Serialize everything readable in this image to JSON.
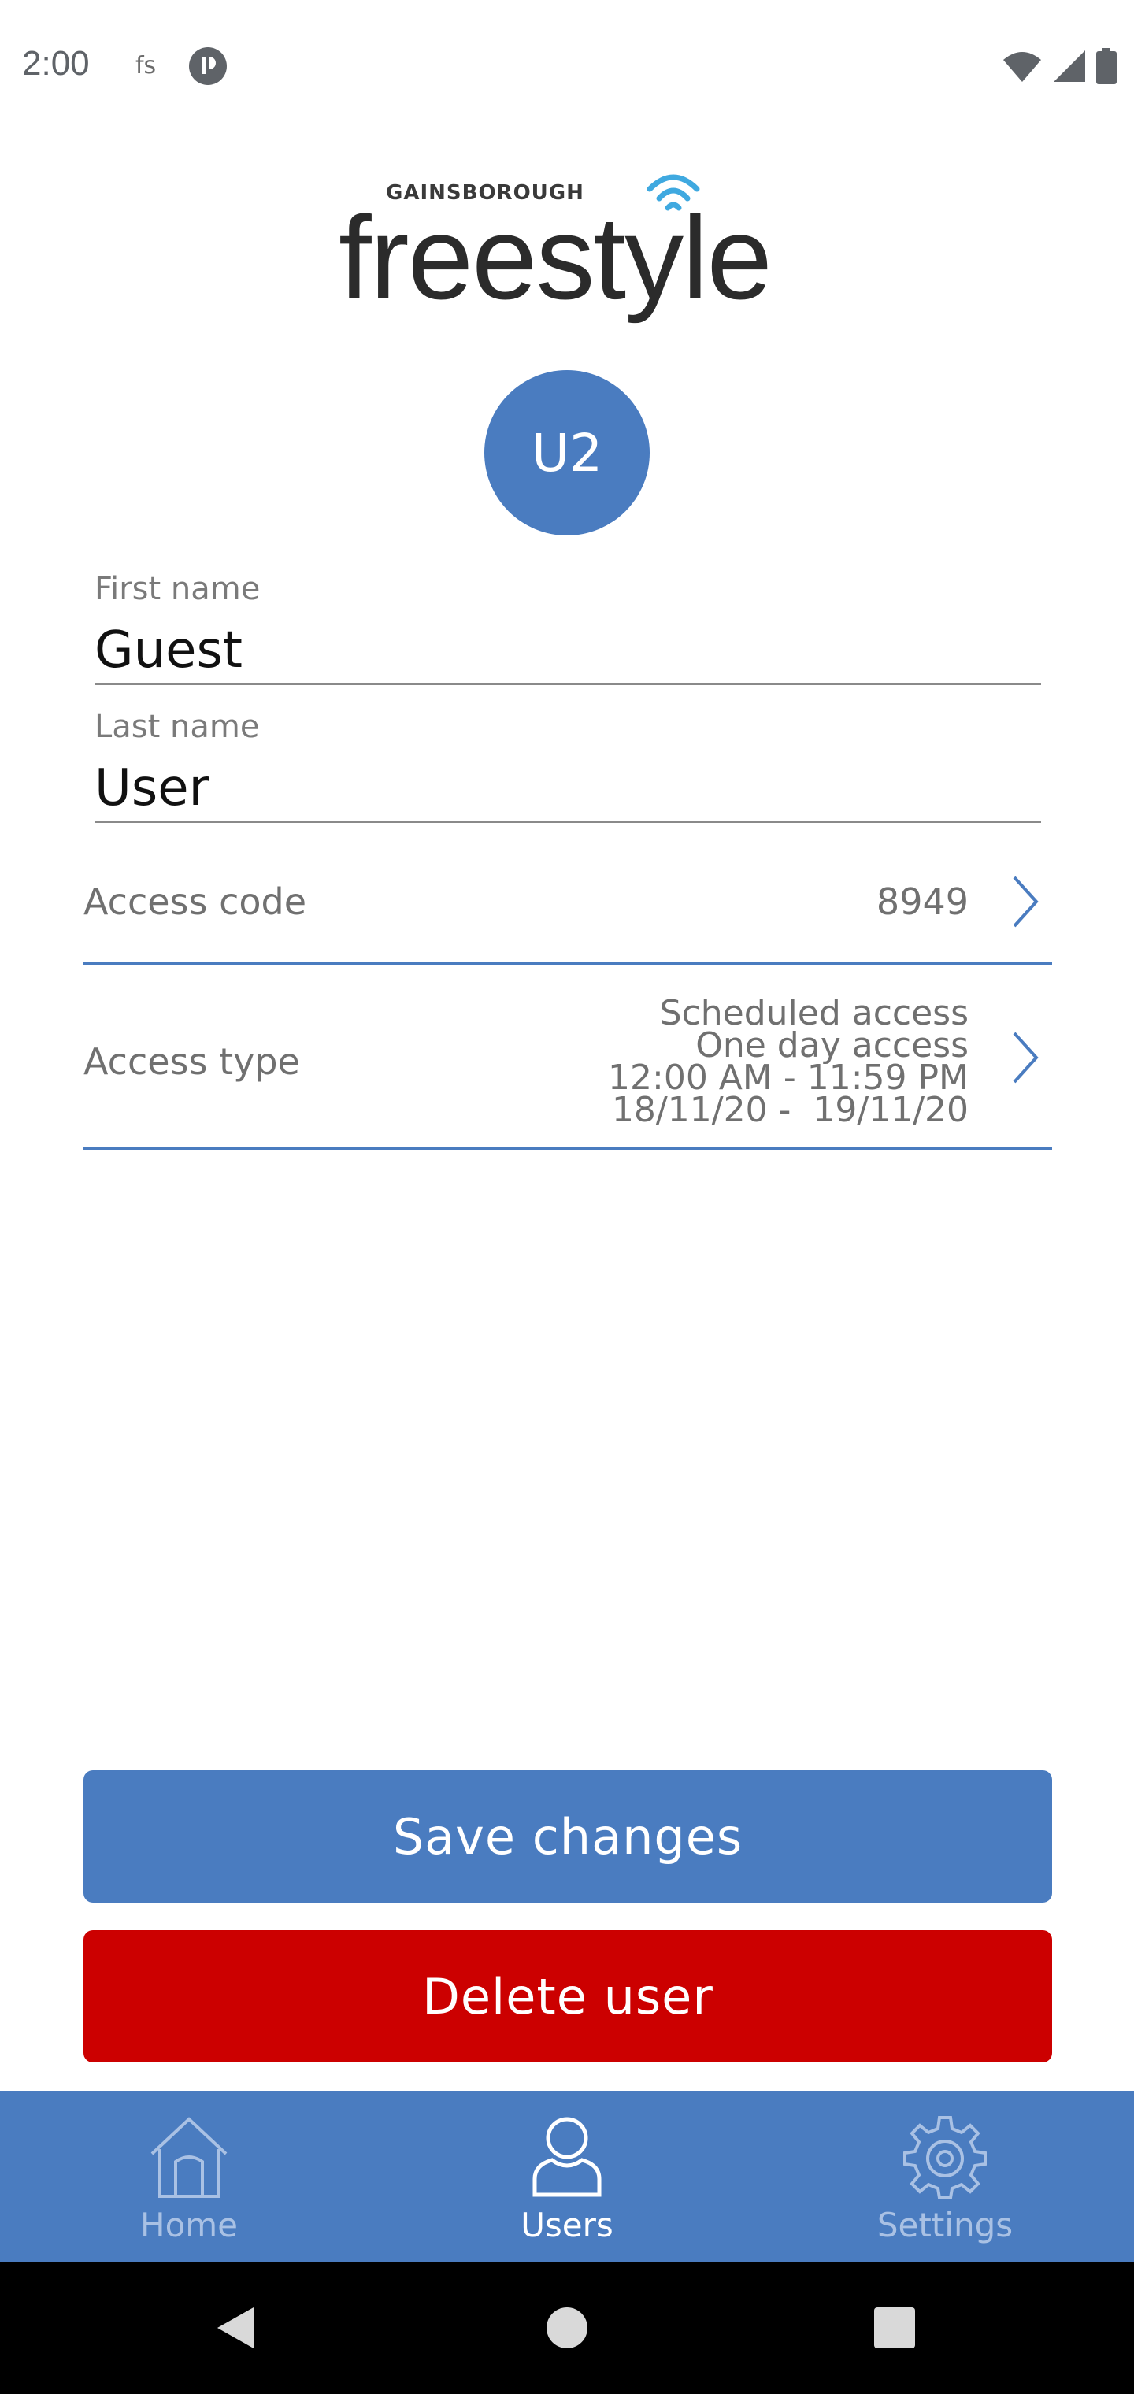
{
  "status_bar": {
    "time": "2:00",
    "fs_label": "fs"
  },
  "logo": {
    "brand_top": "GAINSBOROUGH",
    "brand_main": "freestyle"
  },
  "avatar": {
    "initials": "U2"
  },
  "form": {
    "first_name": {
      "label": "First name",
      "value": "Guest"
    },
    "last_name": {
      "label": "Last name",
      "value": "User"
    },
    "access_code": {
      "label": "Access code",
      "value": "8949"
    },
    "access_type": {
      "label": "Access type",
      "lines": [
        "Scheduled access",
        "One day access",
        "12:00 AM - 11:59 PM",
        "18/11/20 -  19/11/20"
      ]
    }
  },
  "buttons": {
    "save": "Save changes",
    "delete": "Delete user"
  },
  "bottom_nav": {
    "items": [
      {
        "label": "Home",
        "icon": "home-icon",
        "active": false
      },
      {
        "label": "Users",
        "icon": "user-icon",
        "active": true
      },
      {
        "label": "Settings",
        "icon": "gear-icon",
        "active": false
      }
    ]
  },
  "colors": {
    "accent": "#4a7cc0",
    "danger": "#cc0000",
    "nav_inactive": "#a9c1e4"
  }
}
